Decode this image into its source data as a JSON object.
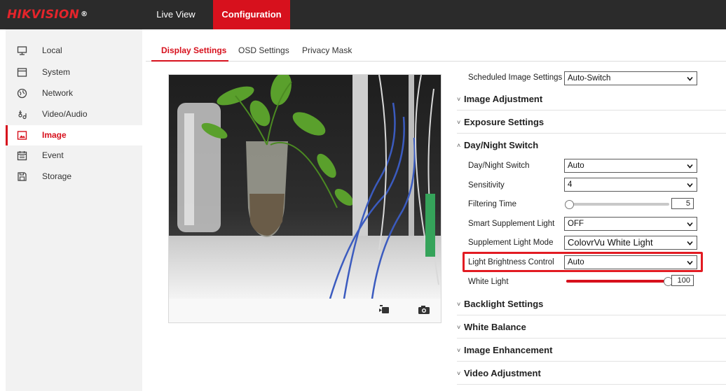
{
  "app": {
    "logo": "HIKVISION",
    "logo_mark": "®"
  },
  "nav": {
    "live_view": "Live View",
    "configuration": "Configuration"
  },
  "sidebar": {
    "items": [
      {
        "label": "Local",
        "icon": "monitor-icon"
      },
      {
        "label": "System",
        "icon": "system-icon"
      },
      {
        "label": "Network",
        "icon": "globe-icon"
      },
      {
        "label": "Video/Audio",
        "icon": "video-audio-icon"
      },
      {
        "label": "Image",
        "icon": "image-icon",
        "active": true
      },
      {
        "label": "Event",
        "icon": "calendar-icon"
      },
      {
        "label": "Storage",
        "icon": "storage-icon"
      }
    ]
  },
  "tabs": {
    "display": "Display Settings",
    "osd": "OSD Settings",
    "privacy": "Privacy Mask"
  },
  "settings": {
    "scheduled": {
      "label": "Scheduled Image Settings",
      "value": "Auto-Switch"
    },
    "sections": {
      "image_adjustment": "Image Adjustment",
      "exposure": "Exposure Settings",
      "day_night": "Day/Night Switch",
      "backlight": "Backlight Settings",
      "white_balance": "White Balance",
      "image_enhancement": "Image Enhancement",
      "video_adjustment": "Video Adjustment"
    },
    "day_night": {
      "switch": {
        "label": "Day/Night Switch",
        "value": "Auto"
      },
      "sensitivity": {
        "label": "Sensitivity",
        "value": "4"
      },
      "filtering": {
        "label": "Filtering Time",
        "value": "5",
        "level": 0.0
      },
      "smart_light": {
        "label": "Smart Supplement Light",
        "value": "OFF"
      },
      "light_mode": {
        "label": "Supplement Light Mode",
        "value": "ColovrVu White Light"
      },
      "brightness_control": {
        "label": "Light Brightness Control",
        "value": "Auto"
      },
      "white_light": {
        "label": "White Light",
        "value": "100",
        "level": 1.0
      }
    }
  },
  "colors": {
    "accent": "#d7111d",
    "topbar": "#2b2b2b",
    "sidebar": "#f2f2f2",
    "highlight": "#e21b22"
  }
}
